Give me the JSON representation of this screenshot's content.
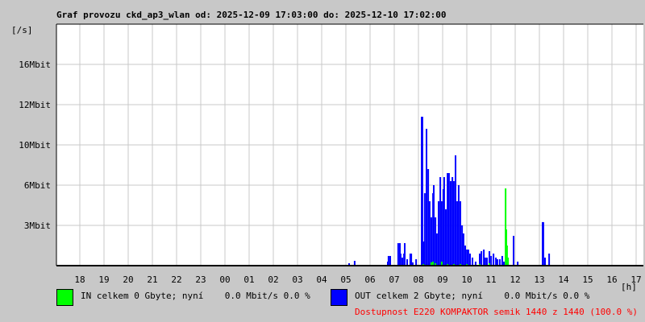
{
  "chart_data": {
    "type": "bar",
    "title": "Graf provozu ckd_ap3_wlan od: 2025-12-09 17:03:00 do: 2025-12-10 17:02:00",
    "ylabel": "[/s]",
    "xlabel": "[h]",
    "x_unit": "hours since 2025-12-09 17:03",
    "xlim": [
      0,
      24.3
    ],
    "y_unit": "Mbit/s",
    "ylim": [
      0,
      19.2
    ],
    "ytick_labels": [
      "3Mbit",
      "6Mbit",
      "10Mbit",
      "12Mbit",
      "16Mbit"
    ],
    "xtick_labels": [
      "18",
      "19",
      "20",
      "21",
      "22",
      "23",
      "00",
      "01",
      "02",
      "03",
      "04",
      "05",
      "06",
      "07",
      "08",
      "09",
      "10",
      "11",
      "12",
      "13",
      "14",
      "15",
      "16",
      "17"
    ],
    "grid": true,
    "series": [
      {
        "name": "OUT",
        "color": "#0000ff",
        "points": [
          [
            12.1,
            0.19
          ],
          [
            12.33,
            0.38
          ],
          [
            13.7,
            0.32
          ],
          [
            13.73,
            0.77
          ],
          [
            13.8,
            0.77
          ],
          [
            14.13,
            1.79
          ],
          [
            14.2,
            1.79
          ],
          [
            14.23,
            0.96
          ],
          [
            14.3,
            0.64
          ],
          [
            14.37,
            0.96
          ],
          [
            14.4,
            1.79
          ],
          [
            14.5,
            0.51
          ],
          [
            14.63,
            0.96
          ],
          [
            14.67,
            0.96
          ],
          [
            14.73,
            0.26
          ],
          [
            14.87,
            0.51
          ],
          [
            15.1,
            11.84
          ],
          [
            15.13,
            11.84
          ],
          [
            15.17,
            1.92
          ],
          [
            15.23,
            5.76
          ],
          [
            15.3,
            10.88
          ],
          [
            15.37,
            7.68
          ],
          [
            15.43,
            5.12
          ],
          [
            15.5,
            3.84
          ],
          [
            15.57,
            5.76
          ],
          [
            15.6,
            6.4
          ],
          [
            15.67,
            3.84
          ],
          [
            15.73,
            2.56
          ],
          [
            15.8,
            5.12
          ],
          [
            15.87,
            7.04
          ],
          [
            15.93,
            5.12
          ],
          [
            16.0,
            6.08
          ],
          [
            16.03,
            7.04
          ],
          [
            16.1,
            4.48
          ],
          [
            16.17,
            7.36
          ],
          [
            16.23,
            7.36
          ],
          [
            16.3,
            6.72
          ],
          [
            16.37,
            7.04
          ],
          [
            16.43,
            6.72
          ],
          [
            16.5,
            8.77
          ],
          [
            16.57,
            5.12
          ],
          [
            16.63,
            6.4
          ],
          [
            16.7,
            5.12
          ],
          [
            16.77,
            3.2
          ],
          [
            16.83,
            2.56
          ],
          [
            16.9,
            1.6
          ],
          [
            16.97,
            1.28
          ],
          [
            17.03,
            1.28
          ],
          [
            17.1,
            0.96
          ],
          [
            17.2,
            0.64
          ],
          [
            17.33,
            0.32
          ],
          [
            17.5,
            0.96
          ],
          [
            17.57,
            1.15
          ],
          [
            17.67,
            1.28
          ],
          [
            17.73,
            0.64
          ],
          [
            17.8,
            0.64
          ],
          [
            17.9,
            1.15
          ],
          [
            17.97,
            0.77
          ],
          [
            18.07,
            0.96
          ],
          [
            18.17,
            0.64
          ],
          [
            18.23,
            0.51
          ],
          [
            18.33,
            0.51
          ],
          [
            18.43,
            0.77
          ],
          [
            18.5,
            0.32
          ],
          [
            18.9,
            2.37
          ],
          [
            19.07,
            0.32
          ],
          [
            20.1,
            3.46
          ],
          [
            20.13,
            3.46
          ],
          [
            20.2,
            0.64
          ],
          [
            20.37,
            0.96
          ]
        ]
      },
      {
        "name": "IN",
        "color": "#00ff00",
        "points": [
          [
            15.17,
            0.13
          ],
          [
            15.5,
            0.26
          ],
          [
            15.57,
            0.32
          ],
          [
            15.67,
            0.19
          ],
          [
            15.93,
            0.32
          ],
          [
            16.17,
            0.13
          ],
          [
            16.43,
            0.13
          ],
          [
            16.7,
            0.13
          ],
          [
            16.97,
            0.13
          ],
          [
            17.5,
            0.13
          ],
          [
            17.9,
            0.19
          ],
          [
            18.57,
            6.14
          ],
          [
            18.6,
            2.88
          ],
          [
            18.63,
            1.6
          ],
          [
            18.67,
            0.64
          ]
        ]
      }
    ]
  },
  "legend": {
    "in_text": "IN celkem 0 Gbyte; nyní    0.0 Mbit/s 0.0 %",
    "out_text": "OUT celkem 2 Gbyte; nyní    0.0 Mbit/s 0.0 %",
    "availability": "Dostupnost E220 KOMPAKTOR semik 1440 z 1440 (100.0 %)",
    "in_color": "#00ff00",
    "out_color": "#0000ff"
  }
}
